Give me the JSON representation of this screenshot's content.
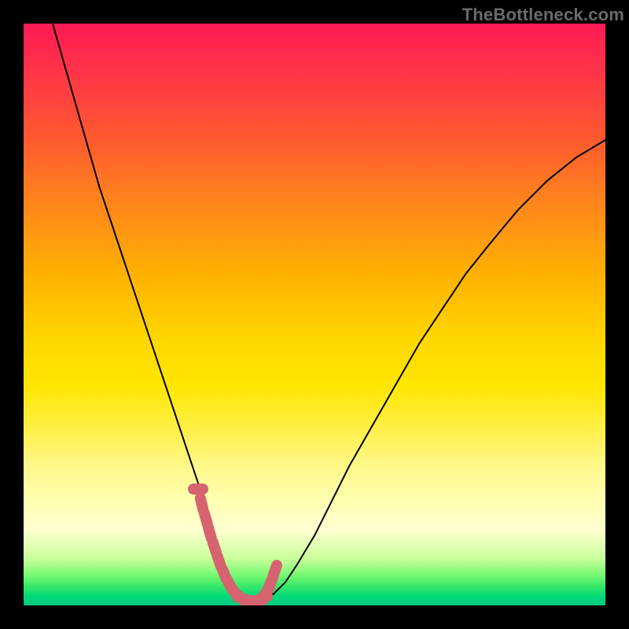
{
  "attribution": "TheBottleneck.com",
  "chart_data": {
    "type": "line",
    "title": "",
    "xlabel": "",
    "ylabel": "",
    "xlim": [
      0,
      100
    ],
    "ylim": [
      0,
      100
    ],
    "series": [
      {
        "name": "bottleneck-curve",
        "x": [
          5,
          7,
          9,
          11,
          13,
          15,
          17,
          19,
          21,
          23,
          25,
          27,
          29,
          30,
          31,
          32,
          33,
          34,
          35,
          36,
          37,
          38,
          39,
          41,
          43,
          45,
          47,
          50,
          53,
          56,
          60,
          64,
          68,
          72,
          76,
          80,
          85,
          90,
          95,
          100
        ],
        "values": [
          100,
          93,
          86,
          79,
          72,
          66,
          60,
          54,
          48,
          42,
          36,
          30,
          24,
          21,
          17,
          13,
          9,
          6,
          3.5,
          2,
          1,
          0.6,
          0.6,
          1,
          2,
          4,
          7,
          12,
          18,
          24,
          31,
          38,
          45,
          51,
          57,
          62,
          68,
          73,
          77,
          80
        ]
      }
    ],
    "markers": {
      "name": "highlighted-range",
      "x": [
        30.0,
        30.6,
        31.3,
        32.0,
        32.8,
        33.6,
        34.5,
        35.4,
        36.3,
        37.5,
        38.8,
        40.0,
        41.0,
        41.8,
        42.5,
        43.2
      ],
      "values": [
        20.0,
        17.5,
        15.0,
        12.5,
        10.0,
        7.6,
        5.4,
        3.6,
        2.2,
        1.2,
        0.8,
        0.8,
        1.2,
        2.4,
        4.0,
        6.0
      ]
    }
  }
}
